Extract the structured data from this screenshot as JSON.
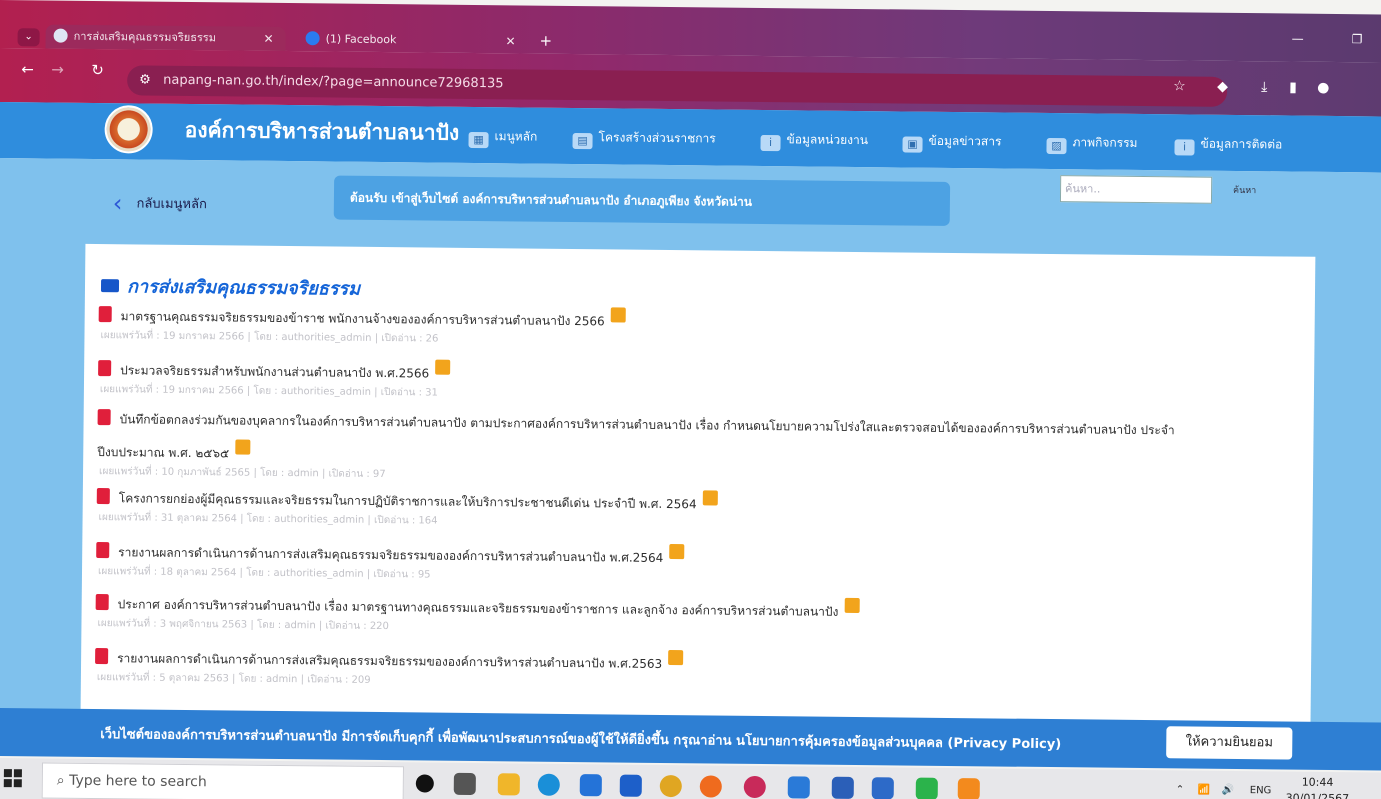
{
  "browser": {
    "tabs": [
      {
        "title": "การส่งเสริมคุณธรรมจริยธรรม",
        "close": "✕"
      },
      {
        "title": "(1) Facebook",
        "close": "✕"
      }
    ],
    "new_tab": "+",
    "url": "napang-nan.go.th/index/?page=announce72968135"
  },
  "site": {
    "name": "องค์การบริหารส่วนตำบลนาปัง",
    "menu": [
      "เมนูหลัก",
      "โครงสร้างส่วนราชการ",
      "ข้อมูลหน่วยงาน",
      "ข้อมูลข่าวสาร",
      "ภาพกิจกรรม",
      "ข้อมูลการติดต่อ"
    ]
  },
  "back_label": "กลับเมนูหลัก",
  "welcome": "ต้อนรับ เข้าสู่เว็บไซต์ องค์การบริหารส่วนตำบลนาปัง อำเภอภูเพียง จังหวัดน่าน",
  "search": {
    "placeholder": "ค้นหา..",
    "button": "ค้นหา"
  },
  "section_title": "การส่งเสริมคุณธรรมจริยธรรม",
  "items": [
    {
      "title": "มาตรฐานคุณธรรมจริยธรรมของข้าราช พนักงานจ้างขององค์การบริหารส่วนตำบลนาปัง 2566",
      "meta": "เผยแพร่วันที่ : 19 มกราคม 2566 | โดย : authorities_admin | เปิดอ่าน : 26"
    },
    {
      "title": "ประมวลจริยธรรมสำหรับพนักงานส่วนตำบลนาปัง พ.ศ.2566",
      "meta": "เผยแพร่วันที่ : 19 มกราคม 2566 | โดย : authorities_admin | เปิดอ่าน : 31"
    },
    {
      "title": "บันทึกข้อตกลงร่วมกันของบุคลากรในองค์การบริหารส่วนตำบลนาปัง ตามประกาศองค์การบริหารส่วนตำบลนาปัง เรื่อง กำหนดนโยบายความโปร่งใสและตรวจสอบได้ขององค์การบริหารส่วนตำบลนาปัง ประจำ",
      "title2": "ปีงบประมาณ พ.ศ. ๒๕๖๕",
      "meta": "เผยแพร่วันที่ : 10 กุมภาพันธ์ 2565 | โดย : admin | เปิดอ่าน : 97"
    },
    {
      "title": "โครงการยกย่องผู้มีคุณธรรมและจริยธรรมในการปฏิบัติราชการและให้บริการประชาชนดีเด่น ประจำปี พ.ศ. 2564",
      "meta": "เผยแพร่วันที่ : 31 ตุลาคม 2564 | โดย : authorities_admin | เปิดอ่าน : 164"
    },
    {
      "title": "รายงานผลการดำเนินการด้านการส่งเสริมคุณธรรมจริยธรรมขององค์การบริหารส่วนตำบลนาปัง พ.ศ.2564",
      "meta": "เผยแพร่วันที่ : 18 ตุลาคม 2564 | โดย : authorities_admin | เปิดอ่าน : 95"
    },
    {
      "title": "ประกาศ องค์การบริหารส่วนตำบลนาปัง เรื่อง มาตรฐานทางคุณธรรมและจริยธรรมของข้าราชการ และลูกจ้าง องค์การบริหารส่วนตำบลนาปัง",
      "meta": "เผยแพร่วันที่ : 3 พฤศจิกายน 2563 | โดย : admin | เปิดอ่าน : 220"
    },
    {
      "title": "รายงานผลการดำเนินการด้านการส่งเสริมคุณธรรมจริยธรรมขององค์การบริหารส่วนตำบลนาปัง พ.ศ.2563",
      "meta": "เผยแพร่วันที่ : 5 ตุลาคม 2563 | โดย : admin | เปิดอ่าน : 209"
    }
  ],
  "cookie": {
    "text": "เว็บไซต์ขององค์การบริหารส่วนตำบลนาปัง มีการจัดเก็บคุกกี้ เพื่อพัฒนาประสบการณ์ของผู้ใช้ให้ดียิ่งขึ้น กรุณาอ่าน นโยบายการคุ้มครองข้อมูลส่วนบุคคล (Privacy Policy)",
    "button": "ให้ความยินยอม"
  },
  "taskbar": {
    "search_placeholder": "Type here to search",
    "lang": "ENG",
    "time": "10:44",
    "date": "30/01/2567"
  }
}
